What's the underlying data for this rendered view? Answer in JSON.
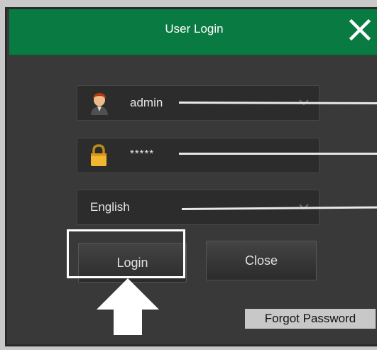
{
  "dialog": {
    "title": "User Login",
    "close_icon": "close-icon"
  },
  "form": {
    "username": {
      "value": "admin",
      "icon": "user-avatar-icon"
    },
    "password": {
      "value": "*****",
      "icon": "lock-icon"
    },
    "language": {
      "value": "English"
    }
  },
  "buttons": {
    "login": "Login",
    "close": "Close",
    "forgot_password": "Forgot Password"
  },
  "annotations": {
    "arrow": "up-arrow-icon"
  },
  "colors": {
    "titlebar": "#0a7a43",
    "dialog_bg": "#393939",
    "highlight": "#ffffff"
  }
}
